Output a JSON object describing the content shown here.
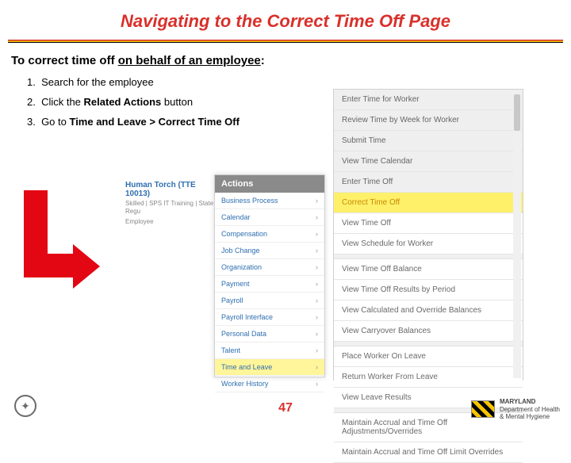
{
  "title": "Navigating to the Correct Time Off Page",
  "intro_lead": "To correct time off ",
  "intro_underline": "on behalf of an employee",
  "intro_tail": ":",
  "steps": [
    {
      "n": "1.",
      "txt": "Search for the employee"
    },
    {
      "n": "2.",
      "pre": "Click the ",
      "b": "Related Actions",
      "post": " button"
    },
    {
      "n": "3.",
      "pre": "Go to ",
      "b": "Time and Leave > Correct Time Off",
      "post": ""
    }
  ],
  "employee": {
    "name": "Human Torch (TTE 10013)",
    "line1": "Skilled | SPS IT Training | State Regu",
    "line2": "Employee"
  },
  "actions": {
    "header": "Actions",
    "items": [
      "Business Process",
      "Calendar",
      "Compensation",
      "Job Change",
      "Organization",
      "Payment",
      "Payroll",
      "Payroll Interface",
      "Personal Data",
      "Talent",
      "Time and Leave",
      "Worker History"
    ],
    "highlight": "Time and Leave"
  },
  "submenu": {
    "items": [
      "Enter Time for Worker",
      "Review Time by Week for Worker",
      "Submit Time",
      "View Time Calendar",
      "Enter Time Off",
      "Correct Time Off",
      "View Time Off",
      "View Schedule for Worker",
      "",
      "View Time Off Balance",
      "View Time Off Results by Period",
      "View Calculated and Override Balances",
      "View Carryover Balances",
      "",
      "Place Worker On Leave",
      "Return Worker From Leave",
      "View Leave Results",
      "",
      "Maintain Accrual and Time Off Adjustments/Overrides",
      "Maintain Accrual and Time Off Limit Overrides"
    ],
    "highlight": "Correct Time Off"
  },
  "page_number": "47",
  "footer": {
    "org1": "MARYLAND",
    "org2": "Department of Health",
    "org3": "& Mental Hygiene"
  }
}
